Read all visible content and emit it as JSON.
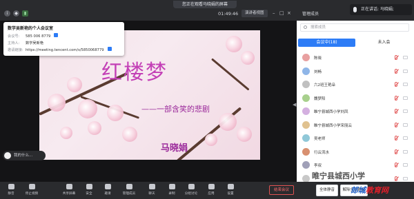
{
  "topbar": {
    "share_banner": "您正在观看马晓娟的屏幕",
    "timer": "01:49:46",
    "view_mode": "演讲者视图",
    "panel_title": "管理成员",
    "speaking": "正在讲话: 马晓娟;"
  },
  "meeting_info": {
    "title": "数学吴新艳的个人会议室",
    "id_label": "会议号:",
    "id_value": "585 006 8779",
    "host_label": "主持人:",
    "host_value": "数学吴新艳",
    "link_label": "邀请链接:",
    "link_value": "https://meeting.tencent.com/s/5850068779"
  },
  "slide": {
    "title": "红楼梦",
    "subtitle": "——一部含笑的悲剧",
    "author": "马晓娟"
  },
  "chat_preview": "我的什么...",
  "panel": {
    "search_placeholder": "搜索成员",
    "tab_active": "会议中(18)",
    "tab_inactive": "未入会",
    "participants": [
      {
        "name": "陈晓",
        "color": "#e8a0a0"
      },
      {
        "name": "刘畅",
        "color": "#8fb6e8"
      },
      {
        "name": "六2班王艳朵",
        "color": "#c0c0c0"
      },
      {
        "name": "魏梦阳",
        "color": "#a8d08d"
      },
      {
        "name": "睢宁县城西小学刘凤",
        "color": "#d4b0e0"
      },
      {
        "name": "睢宁县城西小学宋丽云",
        "color": "#e0c290"
      },
      {
        "name": "吴老师",
        "color": "#90c8d8"
      },
      {
        "name": "行云流水",
        "color": "#d89070"
      },
      {
        "name": "李叔",
        "color": "#a0a0b8"
      },
      {
        "name": "",
        "color": "#c8c8c8"
      }
    ]
  },
  "toolbar": {
    "items": [
      "静音",
      "停止视频",
      "共享屏幕",
      "安全",
      "邀请",
      "管理成员",
      "聊天",
      "录制",
      "分组讨论",
      "应用",
      "设置"
    ],
    "end_meeting": "结束会议",
    "mute_all": "全体静音",
    "unmute_all": "解除全体静音"
  },
  "watermark": {
    "line1": "睢宁县城西小学",
    "line2a": "教育",
    "line2b": "教育网"
  }
}
